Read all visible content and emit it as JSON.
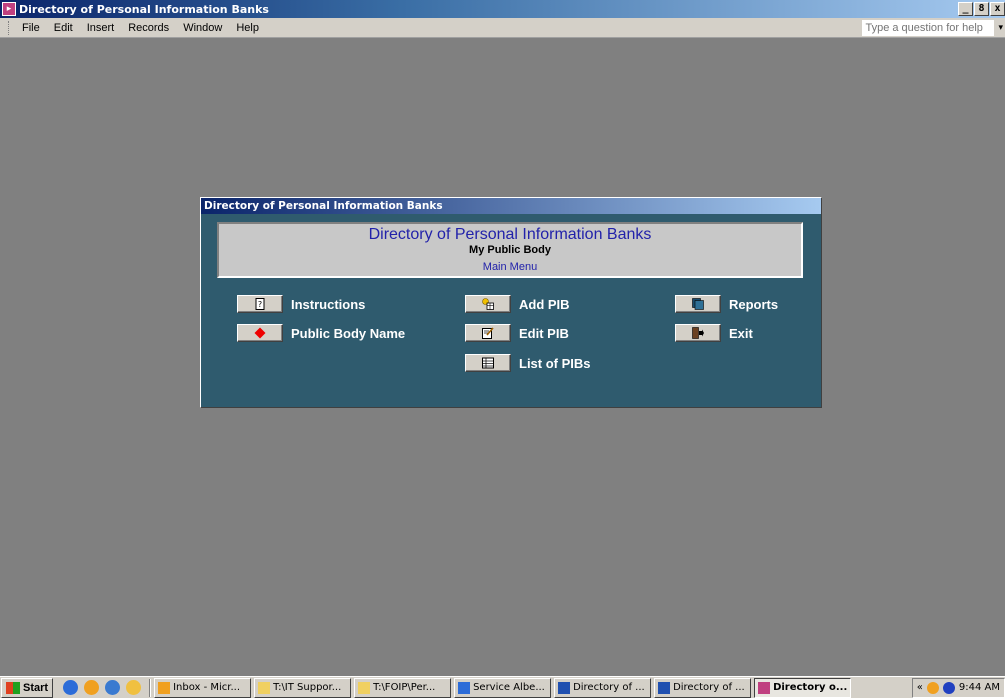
{
  "app": {
    "title": "Directory of Personal Information Banks",
    "controls": [
      "_",
      "8",
      "x"
    ]
  },
  "menu": {
    "items": [
      "File",
      "Edit",
      "Insert",
      "Records",
      "Window",
      "Help"
    ],
    "help_placeholder": "Type a question for help"
  },
  "dialog": {
    "title": "Directory of Personal Information Banks",
    "header_title": "Directory of Personal Information Banks",
    "header_subtitle": "My Public Body",
    "header_menu": "Main Menu",
    "buttons": {
      "instructions": "Instructions",
      "public_body_name": "Public Body Name",
      "add_pib": "Add PIB",
      "edit_pib": "Edit PIB",
      "list_pibs": "List of PIBs",
      "reports": "Reports",
      "exit": "Exit"
    }
  },
  "taskbar": {
    "start": "Start",
    "tasks": [
      {
        "label": "Inbox - Micr...",
        "icon": "outlook-icon",
        "active": false
      },
      {
        "label": "T:\\IT Suppor...",
        "icon": "folder-icon",
        "active": false
      },
      {
        "label": "T:\\FOIP\\Per...",
        "icon": "folder-icon",
        "active": false
      },
      {
        "label": "Service Albe...",
        "icon": "ie-icon",
        "active": false
      },
      {
        "label": "Directory of ...",
        "icon": "word-icon",
        "active": false
      },
      {
        "label": "Directory of ...",
        "icon": "word-icon",
        "active": false
      },
      {
        "label": "Directory o...",
        "icon": "access-icon",
        "active": true
      }
    ],
    "tray_chevron": "«",
    "time": "9:44 AM"
  },
  "colors": {
    "dialog_bg": "#2f5b6e",
    "title_blue": "#0a246a",
    "header_text_blue": "#2222aa"
  }
}
